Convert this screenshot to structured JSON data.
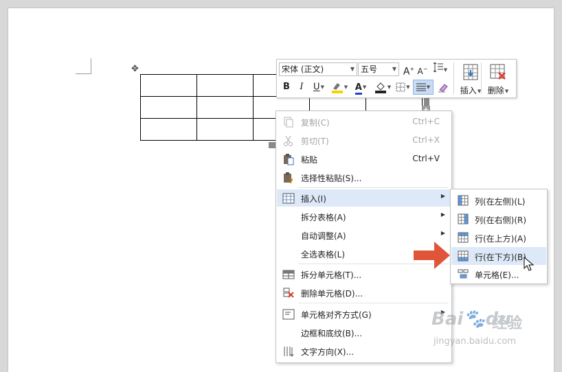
{
  "toolbar": {
    "font_name": "宋体 (正文)",
    "font_size": "五号",
    "insert_label": "插入",
    "delete_label": "删除",
    "bold": "B",
    "italic": "I",
    "underline": "U",
    "font_color_letter": "A",
    "grow_font": "A",
    "shrink_font": "A"
  },
  "context_menu": {
    "items": [
      {
        "label": "复制(C)",
        "shortcut": "Ctrl+C",
        "icon": "copy-icon",
        "disabled": true
      },
      {
        "label": "剪切(T)",
        "shortcut": "Ctrl+X",
        "icon": "scissors-icon",
        "disabled": true
      },
      {
        "label": "粘贴",
        "shortcut": "Ctrl+V",
        "icon": "paste-icon",
        "disabled": false
      },
      {
        "label": "选择性粘贴(S)...",
        "icon": "paste-special-icon",
        "disabled": false
      },
      {
        "label": "插入(I)",
        "icon": "table-icon",
        "submenu": true,
        "highlighted": true
      },
      {
        "label": "拆分表格(A)",
        "submenu": true
      },
      {
        "label": "自动调整(A)",
        "submenu": true
      },
      {
        "label": "全选表格(L)"
      },
      {
        "label": "拆分单元格(T)...",
        "icon": "split-cells-icon"
      },
      {
        "label": "删除单元格(D)...",
        "icon": "delete-cells-icon"
      },
      {
        "label": "单元格对齐方式(G)",
        "icon": "cell-align-icon",
        "submenu": true
      },
      {
        "label": "边框和底纹(B)..."
      },
      {
        "label": "文字方向(X)...",
        "icon": "text-direction-icon"
      }
    ]
  },
  "insert_submenu": {
    "items": [
      {
        "label": "列(在左侧)(L)",
        "icon": "insert-col-left-icon"
      },
      {
        "label": "列(在右侧)(R)",
        "icon": "insert-col-right-icon"
      },
      {
        "label": "行(在上方)(A)",
        "icon": "insert-row-above-icon"
      },
      {
        "label": "行(在下方)(B)",
        "icon": "insert-row-below-icon",
        "highlighted": true
      },
      {
        "label": "单元格(E)...",
        "icon": "insert-cell-icon"
      }
    ]
  },
  "watermark": {
    "brand_cn": "经验",
    "url": "jingyan.baidu.com"
  },
  "colors": {
    "highlight": "#dde9f8",
    "annotation_arrow": "#e0553a",
    "font_color_bar": "#1f3fd1",
    "highlighter_bar": "#f5d200"
  }
}
